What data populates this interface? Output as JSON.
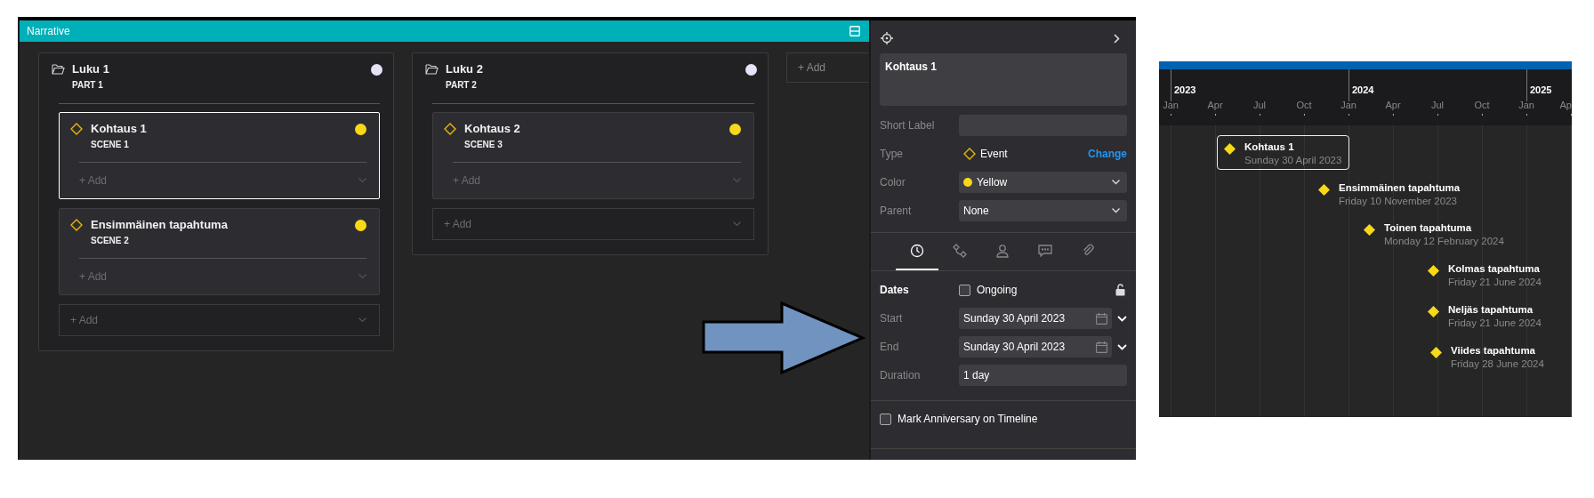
{
  "board": {
    "header": {
      "title": "Narrative"
    },
    "columns": [
      {
        "title": "Luku 1",
        "subtitle": "PART 1",
        "color": "#e4e4f6",
        "add_label": "+ Add",
        "cards": [
          {
            "title": "Kohtaus 1",
            "subtitle": "SCENE 1",
            "color": "#f7d917",
            "selected": true,
            "add_label": "+ Add"
          },
          {
            "title": "Ensimmäinen tapahtuma",
            "subtitle": "SCENE 2",
            "color": "#f7d917",
            "selected": false,
            "add_label": "+ Add"
          }
        ]
      },
      {
        "title": "Luku 2",
        "subtitle": "PART 2",
        "color": "#e4e4f6",
        "add_label": "+ Add",
        "cards": [
          {
            "title": "Kohtaus 2",
            "subtitle": "SCENE 3",
            "color": "#f7d917",
            "selected": false,
            "add_label": "+ Add"
          }
        ]
      }
    ],
    "add_column_label": "+ Add"
  },
  "inspector": {
    "title": "Kohtaus 1",
    "short_label": {
      "label": "Short Label"
    },
    "type": {
      "label": "Type",
      "value": "Event",
      "action": "Change"
    },
    "color": {
      "label": "Color",
      "value": "Yellow",
      "color": "#f7d917"
    },
    "parent": {
      "label": "Parent",
      "value": "None"
    },
    "tabs": [
      {
        "selected": true
      },
      {
        "selected": false
      },
      {
        "selected": false
      },
      {
        "selected": false
      },
      {
        "selected": false
      }
    ],
    "dates": {
      "label": "Dates",
      "ongoing": {
        "label": "Ongoing",
        "checked": false
      },
      "start": {
        "label": "Start",
        "value": "Sunday 30 April 2023"
      },
      "end": {
        "label": "End",
        "value": "Sunday 30 April 2023"
      },
      "duration": {
        "label": "Duration",
        "value": "1 day"
      }
    },
    "anniversary": {
      "label": "Mark Anniversary on Timeline",
      "checked": false
    }
  },
  "timeline": {
    "years": [
      "2023",
      "2024",
      "2025"
    ],
    "months": [
      "Jan",
      "Apr",
      "Jul",
      "Oct",
      "Jan",
      "Apr",
      "Jul",
      "Oct",
      "Jan",
      "Ap"
    ],
    "events": [
      {
        "name": "Kohtaus 1",
        "date": "Sunday 30 April 2023",
        "selected": true
      },
      {
        "name": "Ensimmäinen tapahtuma",
        "date": "Friday 10 November 2023",
        "selected": false
      },
      {
        "name": "Toinen tapahtuma",
        "date": "Monday 12 February 2024",
        "selected": false
      },
      {
        "name": "Kolmas tapahtuma",
        "date": "Friday 21 June 2024",
        "selected": false
      },
      {
        "name": "Neljäs tapahtuma",
        "date": "Friday 21 June 2024",
        "selected": false
      },
      {
        "name": "Viides tapahtuma",
        "date": "Friday 28 June 2024",
        "selected": false
      }
    ]
  }
}
